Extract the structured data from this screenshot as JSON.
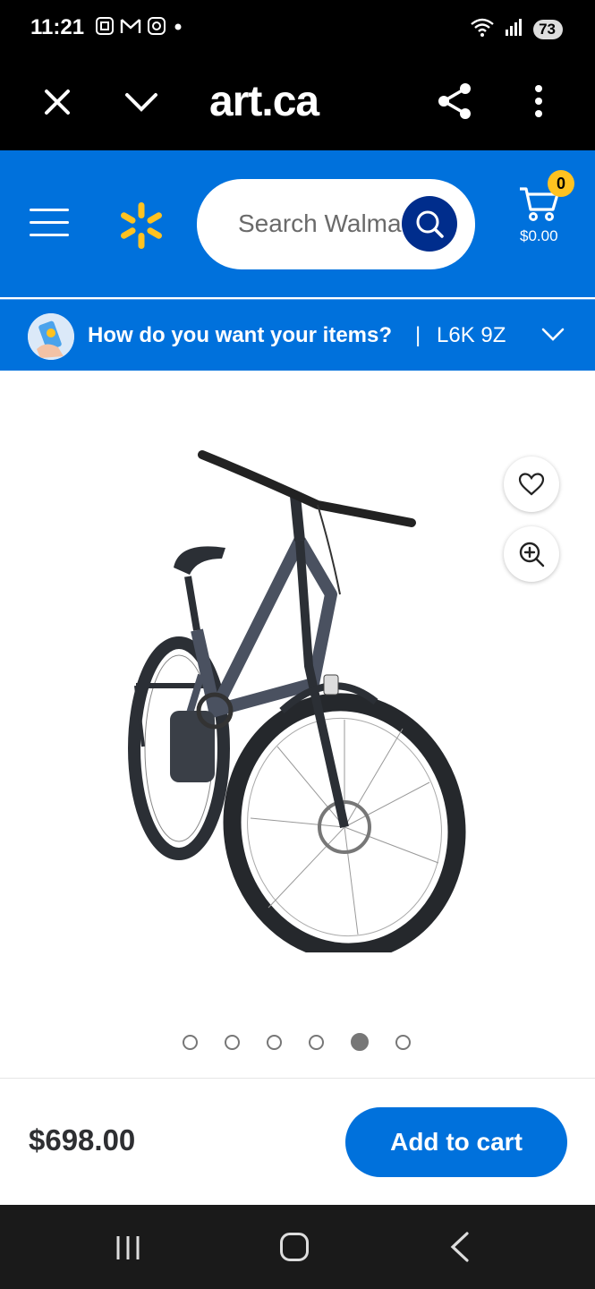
{
  "status_bar": {
    "time": "11:21",
    "battery": "73"
  },
  "browser": {
    "url_display": "art.ca",
    "icons": [
      "close-icon",
      "chevron-down-icon",
      "share-icon",
      "more-vert-icon"
    ]
  },
  "header": {
    "search_placeholder": "Search Walmart",
    "cart_count": "0",
    "cart_total": "$0.00",
    "brand_color": "#0071dc",
    "spark_color": "#ffc220"
  },
  "delivery": {
    "question": "How do you want your items?",
    "separator": "|",
    "postal_code": "L6K 9Z"
  },
  "product": {
    "image_count": 6,
    "active_image_index": 4,
    "price": "$698.00",
    "add_to_cart_label": "Add to cart"
  }
}
